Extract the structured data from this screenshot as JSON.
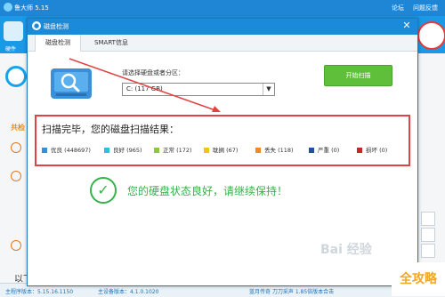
{
  "app": {
    "title": "鲁大师 5.15",
    "titlebar_right": [
      "论坛",
      "问题反馈"
    ],
    "left_label": "共检",
    "bottom_text": "以下时候检测问题",
    "toolbar_label": "硬件"
  },
  "dialog": {
    "title": "磁盘检测",
    "tabs": [
      "磁盘检测",
      "SMART信息"
    ],
    "select_label": "请选择硬盘或者分区：",
    "drive_value": "C:  (117 GB)",
    "start_button": "开始扫描",
    "result_title": "扫描完毕，您的磁盘扫描结果：",
    "legend": [
      {
        "label": "优良 (448697)",
        "color": "#3a8ed4"
      },
      {
        "label": "良好 (965)",
        "color": "#2fbde0"
      },
      {
        "label": "正常 (172)",
        "color": "#8dc63f"
      },
      {
        "label": "耽搁 (67)",
        "color": "#f0c419"
      },
      {
        "label": "丢失 (118)",
        "color": "#f08a24"
      },
      {
        "label": "严重 (0)",
        "color": "#1f4fa8"
      },
      {
        "label": "损坏 (0)",
        "color": "#c62828"
      }
    ],
    "status_message": "您的硬盘状态良好，请继续保持！"
  },
  "statusbar": {
    "left": "主程序版本：5.15.16.1150",
    "middle": "主设备版本：4.1.0.1020",
    "right": "蓝月传奇  刀刀采声  1.85倍版本合击"
  },
  "watermark": "Bai 经验",
  "brand": "全攻略"
}
